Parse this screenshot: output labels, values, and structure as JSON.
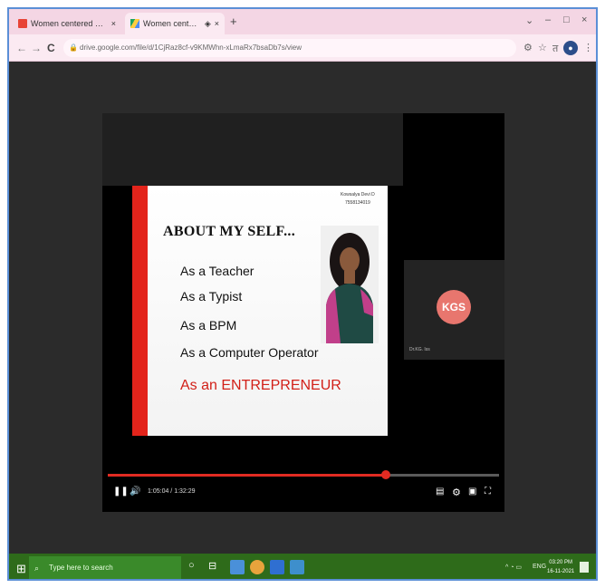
{
  "browser": {
    "tabs": [
      {
        "title": "Women centered Programme (I",
        "close": "×",
        "favicon": "gmail-icon"
      },
      {
        "title": "Women centered Programme",
        "close": "×",
        "favicon": "drive-icon",
        "extra": "◈"
      }
    ],
    "new_tab": "+",
    "window_controls": [
      "⌄",
      "–",
      "□",
      "×"
    ],
    "nav": {
      "back": "←",
      "forward": "→",
      "reload": "C"
    },
    "url": "drive.google.com/file/d/1CjRaz8cf-v9KMWhn-xLmaRx7bsaDb7s/view",
    "toolbar_icons": [
      "⚙",
      "☆",
      "त"
    ],
    "profile_initial": "●"
  },
  "slide": {
    "heading": "ABOUT MY SELF...",
    "items": [
      "As a Teacher",
      "As a Typist",
      "As a BPM",
      "As a Computer Operator"
    ],
    "highlight": "As an ENTREPRENEUR",
    "presenter_name": "Kowsalya Devi D",
    "presenter_phone": "7558134019"
  },
  "participant": {
    "initials": "KGS",
    "label": "Dr.KG. Iss"
  },
  "player": {
    "time": "1:05:04 / 1:32:29",
    "progress": 0.71,
    "pause": "❚❚",
    "volume": "🔊"
  },
  "taskbar": {
    "search_placeholder": "Type here to search",
    "tray_text": "ENG",
    "time": "03:20 PM",
    "date": "16-11-2021"
  }
}
